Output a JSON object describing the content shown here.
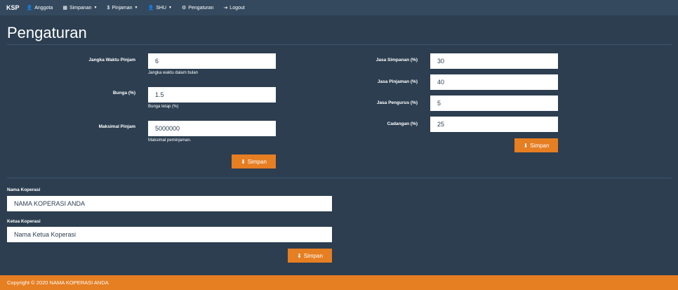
{
  "navbar": {
    "brand": "KSP",
    "items": [
      {
        "icon": "user-icon",
        "glyph": "👤",
        "label": "Anggota",
        "dropdown": false
      },
      {
        "icon": "grid-icon",
        "glyph": "▦",
        "label": "Simpanan",
        "dropdown": true
      },
      {
        "icon": "dollar-icon",
        "glyph": "$",
        "label": "Pinjaman",
        "dropdown": true
      },
      {
        "icon": "user-icon",
        "glyph": "👤",
        "label": "SHU",
        "dropdown": true
      },
      {
        "icon": "gear-icon",
        "glyph": "⚙",
        "label": "Pengaturan",
        "dropdown": false
      },
      {
        "icon": "logout-icon",
        "glyph": "⇥",
        "label": "Logout",
        "dropdown": false
      }
    ]
  },
  "page": {
    "title": "Pengaturan"
  },
  "loan_form": {
    "jangka_label": "Jangka Waktu Pinjam",
    "jangka_value": "6",
    "jangka_help": "Jangka waktu dalam bulan",
    "bunga_label": "Bunga (%)",
    "bunga_value": "1.5",
    "bunga_help": "Bunga tetap (%)",
    "maks_label": "Maksimal Pinjam",
    "maks_value": "5000000",
    "maks_help": "Maksimal peminjaman.",
    "save_label": "Simpan"
  },
  "shu_form": {
    "simpanan_label": "Jasa Simpanan (%)",
    "simpanan_value": "30",
    "pinjaman_label": "Jasa Pinjaman (%)",
    "pinjaman_value": "40",
    "pengurus_label": "Jasa Pengurus (%)",
    "pengurus_value": "5",
    "cadangan_label": "Cadangan (%)",
    "cadangan_value": "25",
    "save_label": "Simpan"
  },
  "koperasi_form": {
    "nama_label": "Nama Koperasi",
    "nama_value": "NAMA KOPERASI ANDA",
    "ketua_label": "Ketua Koperasi",
    "ketua_value": "Nama Ketua Koperasi",
    "save_label": "Simpan"
  },
  "footer": {
    "text": "Copyright © 2020 NAMA KOPERASI ANDA"
  },
  "colors": {
    "background": "#2c3e50",
    "navbar": "#34495e",
    "accent": "#e67e22"
  }
}
